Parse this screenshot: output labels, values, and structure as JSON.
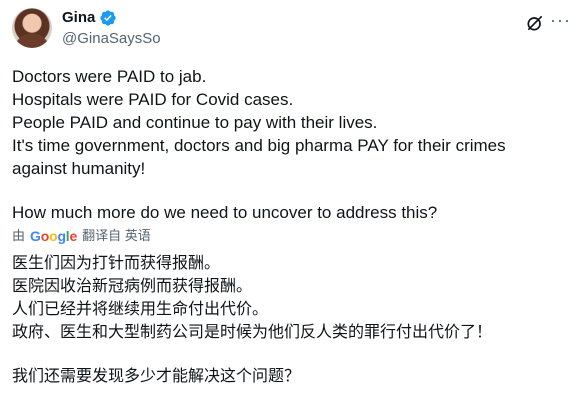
{
  "user": {
    "name": "Gina",
    "handle": "@GinaSaysSo"
  },
  "tweet": {
    "lines": [
      "Doctors were PAID to jab.",
      "Hospitals were PAID for Covid cases.",
      "People PAID and continue to pay with their lives.",
      "It's time government, doctors and big pharma PAY for their crimes",
      "against humanity!"
    ],
    "question": "How much more do we need to uncover to address this?"
  },
  "translation": {
    "by": "由",
    "engine": "Google",
    "label": "翻译自 英语",
    "lines": [
      "医生们因为打针而获得报酬。",
      "医院因收治新冠病例而获得报酬。",
      "人们已经并将继续用生命付出代价。",
      "政府、医生和大型制药公司是时候为他们反人类的罪行付出代价了！"
    ],
    "question": "我们还需要发现多少才能解决这个问题？"
  },
  "colors": {
    "text": "#0f1419",
    "secondary": "#536471",
    "verified": "#1d9bf0"
  }
}
